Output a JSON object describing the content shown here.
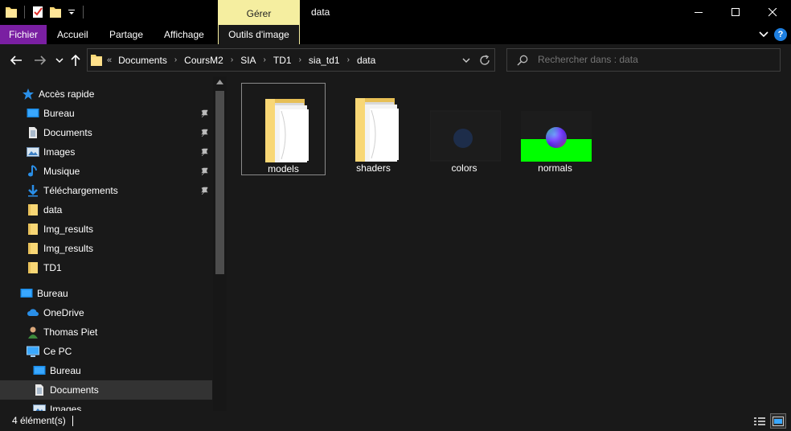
{
  "window": {
    "title": "data",
    "contextual_tab": "Gérer"
  },
  "ribbon": {
    "tabs": [
      "Fichier",
      "Accueil",
      "Partage",
      "Affichage",
      "Outils d'image"
    ],
    "help_label": "?"
  },
  "address": {
    "overflow": "«",
    "crumbs": [
      "Documents",
      "CoursM2",
      "SIA",
      "TD1",
      "sia_td1",
      "data"
    ]
  },
  "search": {
    "placeholder": "Rechercher dans : data"
  },
  "nav": {
    "quick_access": "Accès rapide",
    "pinned": [
      "Bureau",
      "Documents",
      "Images",
      "Musique",
      "Téléchargements"
    ],
    "recent": [
      "data",
      "Img_results",
      "Img_results",
      "TD1"
    ],
    "desktop": "Bureau",
    "onedrive": "OneDrive",
    "user": "Thomas Piet",
    "this_pc": "Ce PC",
    "pc_children": [
      "Bureau",
      "Documents",
      "Images"
    ],
    "selected_item": "Documents"
  },
  "items": [
    {
      "name": "models",
      "kind": "folder",
      "selected": true
    },
    {
      "name": "shaders",
      "kind": "folder",
      "selected": false
    },
    {
      "name": "colors",
      "kind": "image",
      "selected": false
    },
    {
      "name": "normals",
      "kind": "image",
      "selected": false
    }
  ],
  "status": {
    "count_text": "4 élément(s)"
  },
  "colors": {
    "accent_file_tab": "#7a1fa2",
    "contextual_tab": "#f5eea0",
    "selection": "#333333",
    "normals_background": "#00ff00"
  },
  "icons": {
    "quick_access": "star-icon",
    "desktop": "desktop-icon",
    "documents": "document-icon",
    "images": "picture-icon",
    "music": "music-note-icon",
    "downloads": "download-arrow-icon",
    "folder": "folder-icon",
    "onedrive": "cloud-icon",
    "user": "user-icon",
    "pc": "computer-icon",
    "pin": "pin-icon"
  }
}
